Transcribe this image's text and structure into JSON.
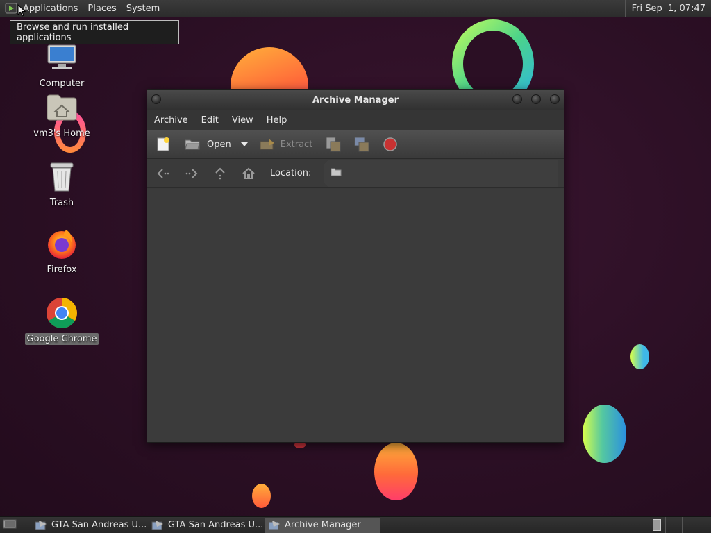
{
  "top_panel": {
    "menus": [
      "Applications",
      "Places",
      "System"
    ],
    "clock": "Fri Sep  1, 07:47"
  },
  "tooltip": "Browse and run installed applications",
  "desktop_icons": [
    {
      "label": "Computer",
      "icon": "computer-icon"
    },
    {
      "label": "vm3's Home",
      "icon": "home-folder-icon"
    },
    {
      "label": "Trash",
      "icon": "trash-icon"
    },
    {
      "label": "Firefox",
      "icon": "firefox-icon"
    },
    {
      "label": "Google Chrome",
      "icon": "chrome-icon",
      "selected": true
    }
  ],
  "window": {
    "title": "Archive Manager",
    "menubar": [
      "Archive",
      "Edit",
      "View",
      "Help"
    ],
    "toolbar": {
      "open_label": "Open",
      "extract_label": "Extract"
    },
    "location_label": "Location:"
  },
  "taskbar": {
    "tasks": [
      {
        "label": "GTA San Andreas U...",
        "active": false
      },
      {
        "label": "GTA San Andreas U...",
        "active": false
      },
      {
        "label": "Archive Manager",
        "active": true
      }
    ]
  },
  "colors": {
    "panel": "#2c2c2c",
    "window_bg": "#3a3a3a",
    "desktop_bg": "#2b0f24"
  }
}
